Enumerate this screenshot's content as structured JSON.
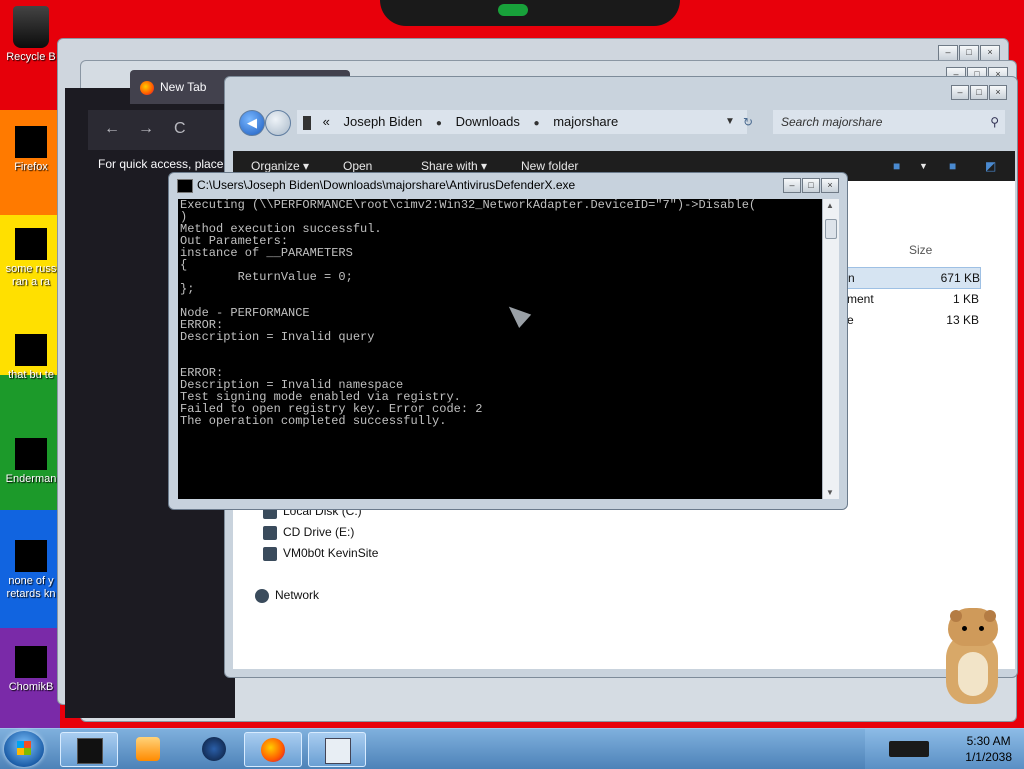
{
  "desktop": {
    "icons": [
      {
        "label": "Recycle B",
        "icon": "recycle-bin-icon"
      },
      {
        "label": "Firefox",
        "icon": "firefox-icon"
      },
      {
        "label": "some russ ran a ra",
        "icon": "file-icon"
      },
      {
        "label": "that bu te",
        "icon": "file-icon"
      },
      {
        "label": "Enderman",
        "icon": "file-icon"
      },
      {
        "label": "none of y retards kn",
        "icon": "file-icon"
      },
      {
        "label": "ChomikB",
        "icon": "file-icon"
      }
    ]
  },
  "browser": {
    "tab_label": "New Tab",
    "nav_back": "←",
    "nav_forward": "→",
    "nav_reload": "C",
    "page_text": "For quick access, place y"
  },
  "explorer": {
    "breadcrumb": {
      "prefix": "«",
      "items": [
        "Joseph Biden",
        "Downloads",
        "majorshare"
      ]
    },
    "search_placeholder": "Search majorshare",
    "toolbar": {
      "organize": "Organize ▾",
      "open": "Open",
      "share_with": "Share with ▾",
      "new_folder": "New folder"
    },
    "columns": {
      "size": "Size"
    },
    "files": [
      {
        "type_partial": "n",
        "size": "671 KB",
        "selected": true
      },
      {
        "type_partial": "ment",
        "size": "1 KB",
        "selected": false
      },
      {
        "type_partial": "e",
        "size": "13 KB",
        "selected": false
      }
    ],
    "nav_items": [
      {
        "label": "Local Disk (C:)",
        "icon": "drive-icon"
      },
      {
        "label": "CD Drive (E:)",
        "icon": "cd-drive-icon"
      },
      {
        "label": "VM0b0t KevinSite",
        "icon": "network-drive-icon"
      },
      {
        "label": "Network",
        "icon": "network-icon"
      }
    ]
  },
  "console": {
    "title": "C:\\Users\\Joseph Biden\\Downloads\\majorshare\\AntivirusDefenderX.exe",
    "lines": [
      "Executing (\\\\PERFORMANCE\\root\\cimv2:Win32_NetworkAdapter.DeviceID=\"7\")->Disable(",
      ")",
      "Method execution successful.",
      "Out Parameters:",
      "instance of __PARAMETERS",
      "{",
      "        ReturnValue = 0;",
      "};",
      "",
      "Node - PERFORMANCE",
      "ERROR:",
      "Description = Invalid query",
      "",
      "",
      "ERROR:",
      "Description = Invalid namespace",
      "Test signing mode enabled via registry.",
      "Failed to open registry key. Error code: 2",
      "The operation completed successfully."
    ]
  },
  "taskbar": {
    "items": [
      "cmd-icon",
      "media-player-icon",
      "globe-icon",
      "firefox-icon",
      "explorer-icon"
    ],
    "clock_time": "5:30 AM",
    "clock_date": "1/1/2038"
  }
}
